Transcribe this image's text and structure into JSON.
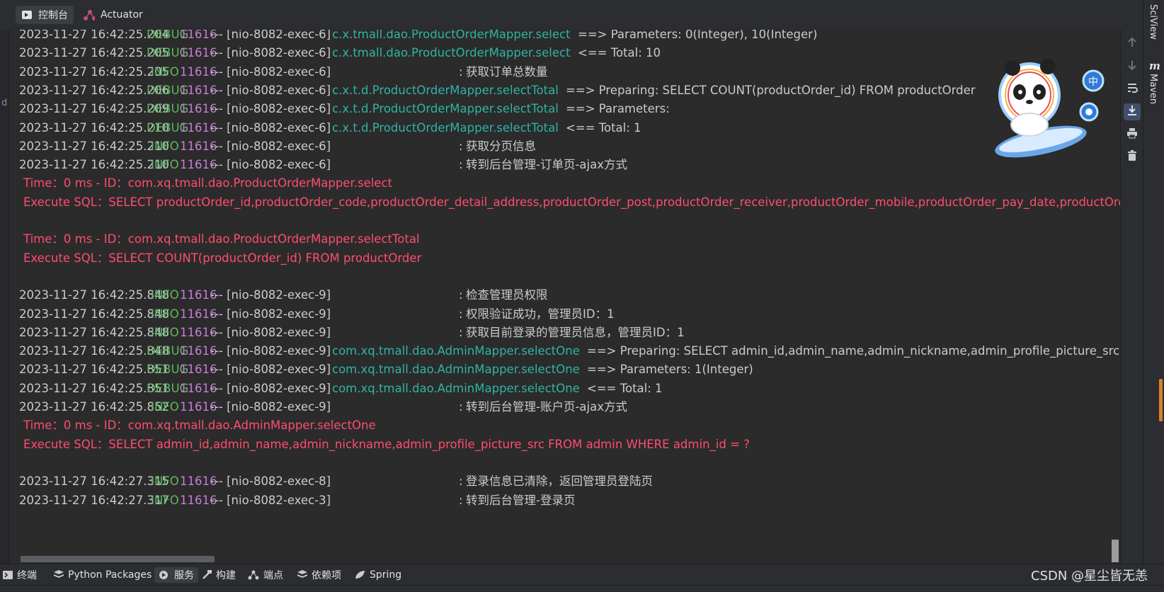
{
  "tabs": [
    {
      "label": "控制台",
      "icon": "console-icon"
    },
    {
      "label": "Actuator",
      "icon": "actuator-icon"
    }
  ],
  "gutter_glyph": "d",
  "console_lines": [
    {
      "kind": "log",
      "ts": "2023-11-27 16:42:25.204",
      "level": "DEBUG",
      "pid": "11616",
      "thread": "--- [nio-8082-exec-6]",
      "logger": "c.x.tmall.dao.ProductOrderMapper.select",
      "msg": "==>  Parameters: 0(Integer), 10(Integer)"
    },
    {
      "kind": "log",
      "ts": "2023-11-27 16:42:25.205",
      "level": "DEBUG",
      "pid": "11616",
      "thread": "--- [nio-8082-exec-6]",
      "logger": "c.x.tmall.dao.ProductOrderMapper.select",
      "msg": "<==      Total: 10"
    },
    {
      "kind": "log",
      "ts": "2023-11-27 16:42:25.205",
      "level": "INFO",
      "pid": "11616",
      "thread": "--- [nio-8082-exec-6]",
      "logger": "",
      "msg": "获取订单总数量"
    },
    {
      "kind": "log",
      "ts": "2023-11-27 16:42:25.206",
      "level": "DEBUG",
      "pid": "11616",
      "thread": "--- [nio-8082-exec-6]",
      "logger": "c.x.t.d.ProductOrderMapper.selectTotal",
      "msg": "==>  Preparing: SELECT COUNT(productOrder_id) FROM productOrder"
    },
    {
      "kind": "log",
      "ts": "2023-11-27 16:42:25.209",
      "level": "DEBUG",
      "pid": "11616",
      "thread": "--- [nio-8082-exec-6]",
      "logger": "c.x.t.d.ProductOrderMapper.selectTotal",
      "msg": "==> Parameters:"
    },
    {
      "kind": "log",
      "ts": "2023-11-27 16:42:25.210",
      "level": "DEBUG",
      "pid": "11616",
      "thread": "--- [nio-8082-exec-6]",
      "logger": "c.x.t.d.ProductOrderMapper.selectTotal",
      "msg": "<==      Total: 1"
    },
    {
      "kind": "log",
      "ts": "2023-11-27 16:42:25.210",
      "level": "INFO",
      "pid": "11616",
      "thread": "--- [nio-8082-exec-6]",
      "logger": "",
      "msg": "获取分页信息"
    },
    {
      "kind": "log",
      "ts": "2023-11-27 16:42:25.210",
      "level": "INFO",
      "pid": "11616",
      "thread": "--- [nio-8082-exec-6]",
      "logger": "",
      "msg": "转到后台管理-订单页-ajax方式"
    },
    {
      "kind": "err",
      "text": "Time：0 ms - ID：com.xq.tmall.dao.ProductOrderMapper.select"
    },
    {
      "kind": "err",
      "text": "Execute SQL：SELECT productOrder_id,productOrder_code,productOrder_detail_address,productOrder_post,productOrder_receiver,productOrder_mobile,productOrder_pay_date,productOrder_delivery_date"
    },
    {
      "kind": "blank"
    },
    {
      "kind": "err",
      "text": "Time：0 ms - ID：com.xq.tmall.dao.ProductOrderMapper.selectTotal"
    },
    {
      "kind": "err",
      "text": "Execute SQL：SELECT COUNT(productOrder_id) FROM productOrder"
    },
    {
      "kind": "blank"
    },
    {
      "kind": "log",
      "ts": "2023-11-27 16:42:25.848",
      "level": "INFO",
      "pid": "11616",
      "thread": "--- [nio-8082-exec-9]",
      "logger": "",
      "msg": "检查管理员权限"
    },
    {
      "kind": "log",
      "ts": "2023-11-27 16:42:25.848",
      "level": "INFO",
      "pid": "11616",
      "thread": "--- [nio-8082-exec-9]",
      "logger": "",
      "msg": "权限验证成功，管理员ID：1"
    },
    {
      "kind": "log",
      "ts": "2023-11-27 16:42:25.848",
      "level": "INFO",
      "pid": "11616",
      "thread": "--- [nio-8082-exec-9]",
      "logger": "",
      "msg": "获取目前登录的管理员信息，管理员ID：1"
    },
    {
      "kind": "log",
      "ts": "2023-11-27 16:42:25.848",
      "level": "DEBUG",
      "pid": "11616",
      "thread": "--- [nio-8082-exec-9]",
      "logger": "com.xq.tmall.dao.AdminMapper.selectOne",
      "msg": "==>  Preparing: SELECT admin_id,admin_name,admin_nickname,admin_profile_picture_src FROM"
    },
    {
      "kind": "log",
      "ts": "2023-11-27 16:42:25.851",
      "level": "DEBUG",
      "pid": "11616",
      "thread": "--- [nio-8082-exec-9]",
      "logger": "com.xq.tmall.dao.AdminMapper.selectOne",
      "msg": "==> Parameters: 1(Integer)"
    },
    {
      "kind": "log",
      "ts": "2023-11-27 16:42:25.851",
      "level": "DEBUG",
      "pid": "11616",
      "thread": "--- [nio-8082-exec-9]",
      "logger": "com.xq.tmall.dao.AdminMapper.selectOne",
      "msg": "<==      Total: 1"
    },
    {
      "kind": "log",
      "ts": "2023-11-27 16:42:25.852",
      "level": "INFO",
      "pid": "11616",
      "thread": "--- [nio-8082-exec-9]",
      "logger": "",
      "msg": "转到后台管理-账户页-ajax方式"
    },
    {
      "kind": "err",
      "text": "Time：0 ms - ID：com.xq.tmall.dao.AdminMapper.selectOne"
    },
    {
      "kind": "err",
      "text": "Execute SQL：SELECT admin_id,admin_name,admin_nickname,admin_profile_picture_src FROM admin WHERE admin_id = ?"
    },
    {
      "kind": "blank"
    },
    {
      "kind": "log",
      "ts": "2023-11-27 16:42:27.315",
      "level": "INFO",
      "pid": "11616",
      "thread": "--- [nio-8082-exec-8]",
      "logger": "",
      "msg": "登录信息已清除，返回管理员登陆页"
    },
    {
      "kind": "log",
      "ts": "2023-11-27 16:42:27.317",
      "level": "INFO",
      "pid": "11616",
      "thread": "--- [nio-8082-exec-3]",
      "logger": "",
      "msg": "转到后台管理-登录页"
    }
  ],
  "right_toolbar": [
    "arrow-up-icon",
    "arrow-down-icon",
    "soft-wrap-icon",
    "scroll-to-end-icon",
    "print-icon",
    "trash-icon"
  ],
  "side_strip": {
    "sciview": "SciView",
    "maven": "Maven"
  },
  "bottom_tabs": [
    {
      "label": "终端",
      "icon": "terminal-icon"
    },
    {
      "label": "Python Packages",
      "icon": "python-packages-icon"
    },
    {
      "label": "服务",
      "icon": "services-icon",
      "active": true
    },
    {
      "label": "构建",
      "icon": "build-icon"
    },
    {
      "label": "端点",
      "icon": "endpoints-icon"
    },
    {
      "label": "依赖项",
      "icon": "dependencies-icon"
    },
    {
      "label": "Spring",
      "icon": "spring-icon"
    }
  ],
  "watermark": "CSDN @星尘皆无恙",
  "colors": {
    "debug": "#5fb862",
    "info": "#5fb862",
    "pid": "#c77dd6",
    "logger": "#2fb3a6",
    "error": "#ff4d6d"
  }
}
